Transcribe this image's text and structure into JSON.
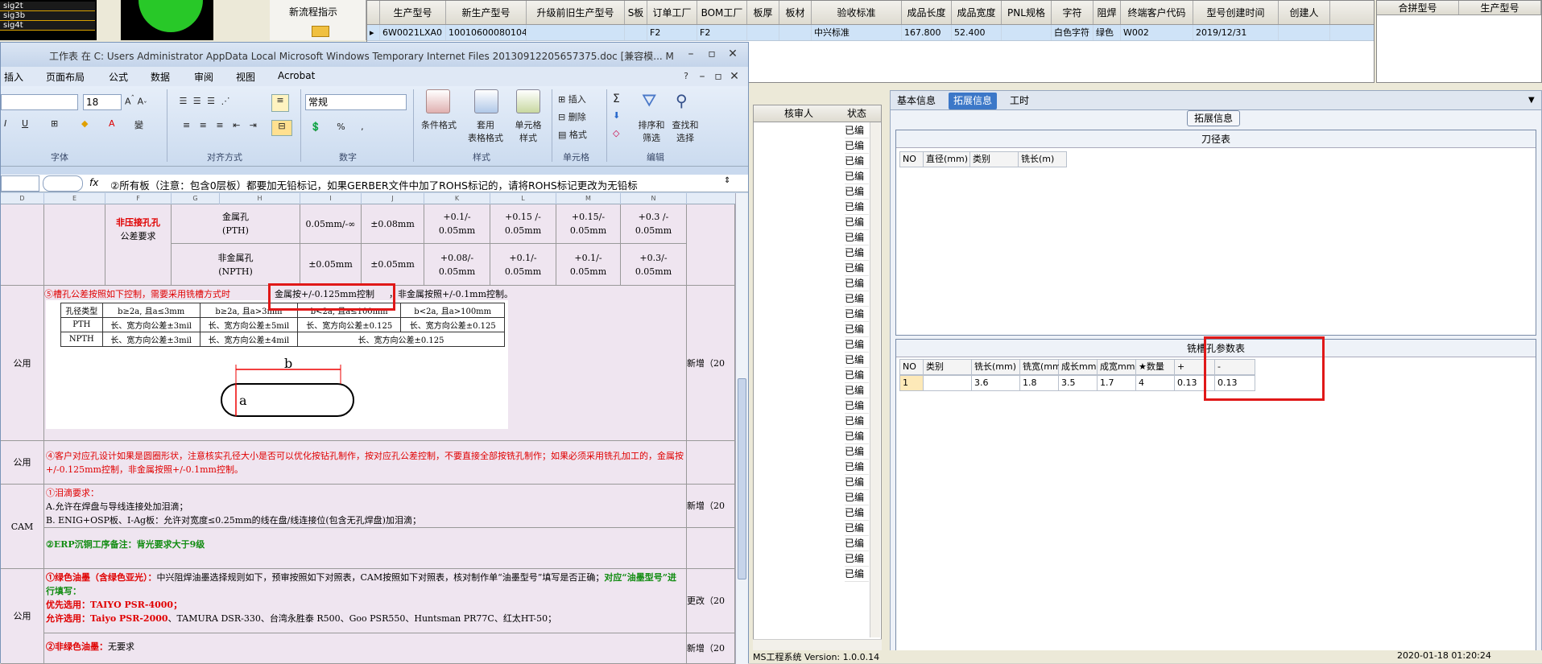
{
  "legacy_list": [
    "sig2t",
    "sig3b",
    "sig4t"
  ],
  "new_flow": "新流程指示",
  "top_grid": {
    "headers": [
      "",
      "生产型号",
      "新生产型号",
      "升级前旧生产型号",
      "S板",
      "订单工厂",
      "BOM工厂",
      "板厚",
      "板材",
      "验收标准",
      "成品长度",
      "成品宽度",
      "PNL规格",
      "字符",
      "阻焊",
      "终端客户代码",
      "型号创建时间",
      "创建人"
    ],
    "row": [
      "▸",
      "6W0021LXA0",
      "10010600080104",
      "",
      "",
      "F2",
      "F2",
      "",
      "",
      "中兴标准",
      "167.800",
      "52.400",
      "",
      "白色字符",
      "绿色",
      "W002",
      "2019/12/31",
      ""
    ]
  },
  "right_grid": {
    "headers": [
      "合拼型号",
      "生产型号"
    ]
  },
  "mid_grid": {
    "headers": [
      "核审人",
      "状态"
    ],
    "status_value": "已编"
  },
  "right_panel": {
    "tabs": [
      "基本信息",
      "拓展信息",
      "工时"
    ],
    "ext_label": "拓展信息",
    "knife": {
      "title": "刀径表",
      "headers": [
        "NO",
        "直径(mm)",
        "类别",
        "铣长(m)"
      ]
    },
    "slot": {
      "title": "铣槽孔参数表",
      "headers": [
        "NO",
        "类别",
        "铣长(mm)",
        "铣宽(mm)",
        "成长mm",
        "成宽mm",
        "★数量",
        "+",
        "-"
      ],
      "row": [
        "1",
        "",
        "3.6",
        "1.8",
        "3.5",
        "1.7",
        "4",
        "0.13",
        "0.13"
      ]
    }
  },
  "status_bar": {
    "left": "MS工程系统 Version: 1.0.0.14",
    "right": "2020-01-18 01:20:24"
  },
  "excel": {
    "title": "工作表 在 C: Users Administrator AppData Local Microsoft Windows Temporary Internet Files 20130912205657375.doc  [兼容模... M",
    "menu": [
      "插入",
      "页面布局",
      "公式",
      "数据",
      "审阅",
      "视图",
      "Acrobat"
    ],
    "font_size": "18",
    "number_format": "常规",
    "groups": [
      "字体",
      "对齐方式",
      "数字",
      "样式",
      "单元格",
      "编辑"
    ],
    "buttons": {
      "cond": "条件格式",
      "tablefmt": "套用\n表格格式",
      "cellstyle": "单元格\n样式",
      "insert": "插入",
      "delete": "删除",
      "format": "格式",
      "sort": "排序和\n筛选",
      "find": "查找和\n选择"
    },
    "formula": "②所有板（注意：包含0层板）都要加无铅标记，如果GERBER文件中加了ROHS标记的，请将ROHS标记更改为无铅标",
    "cols": [
      "D",
      "E",
      "F",
      "G",
      "H",
      "I",
      "J",
      "K",
      "L",
      "M",
      "N"
    ],
    "rows": {
      "r1_title": "非压接孔孔",
      "r1_sub": "公差要求",
      "pth": "金属孔\n(PTH)",
      "pth_vals": [
        "0.05mm/-∞",
        "±0.08mm",
        "+0.1/-\n0.05mm",
        "+0.15 /-\n0.05mm",
        "+0.15/-\n0.05mm",
        "+0.3 /-\n0.05mm"
      ],
      "npth": "非金属孔\n(NPTH)",
      "npth_vals": [
        "±0.05mm",
        "±0.05mm",
        "+0.08/-\n0.05mm",
        "+0.1/-\n0.05mm",
        "+0.1/-\n0.05mm",
        "+0.3/-\n0.05mm"
      ],
      "slot_note_a": "⑤槽孔公差按照如下控制，需要采用铣槽方式时",
      "slot_note_b": "金属按+/-0.125mm控制",
      "slot_note_c": "，非金属按照+/-0.1mm控制。",
      "common": "公用",
      "added": "新增（20",
      "changed": "更改（20",
      "cam": "CAM",
      "img_tbl": [
        [
          "孔径类型",
          "b≥2a, 且a≤3mm",
          "b≥2a, 且a>3mm",
          "b<2a, 且a≤100mm",
          "b<2a, 且a>100mm"
        ],
        [
          "PTH",
          "长、宽方向公差±3mil",
          "长、宽方向公差±5mil",
          "长、宽方向公差±0.125",
          "长、宽方向公差±0.125"
        ],
        [
          "NPTH",
          "长、宽方向公差±3mil",
          "长、宽方向公差±4mil",
          "长、宽方向公差±0.125",
          ""
        ]
      ],
      "img_a": "a",
      "img_b": "b",
      "note4": "④客户对应孔设计如果是圆圈形状，注意核实孔径大小是否可以优化按钻孔制作，按对应孔公差控制，不要直接全部按铣孔制作；如果必须采用铣孔加工的，金属按+/-0.125mm控制，非金属按照+/-0.1mm控制。",
      "tear1": "①泪滴要求：",
      "tear2": "A.允许在焊盘与导线连接处加泪滴；",
      "tear3": "B. ENIG+OSP板、I-Ag板：允许对宽度≤0.25mm的线在盘/线连接位(包含无孔焊盘)加泪滴；",
      "erp": "②ERP沉铜工序备注：背光要求大于9级",
      "green_a": "①绿色油墨（含绿色亚光）：",
      "green_b": "中兴阻焊油墨选择规则如下，预审按照如下对照表，CAM按照如下对照表，核对制作单“油墨型号”填写是否正确；",
      "green_c": "对应“油墨型号”进行填写：",
      "pref_a": "优先选用：",
      "pref_b": "TAIYO PSR-4000；",
      "allow_a": "允许选用：",
      "allow_b": "Taiyo PSR-2000",
      "allow_c": "、TAMURA DSR-330、台湾永胜泰 R500、Goo PSR550、Huntsman PR77C、红太HT-50；",
      "nongreen_a": "②非绿色油墨：",
      "nongreen_b": "无要求"
    }
  }
}
